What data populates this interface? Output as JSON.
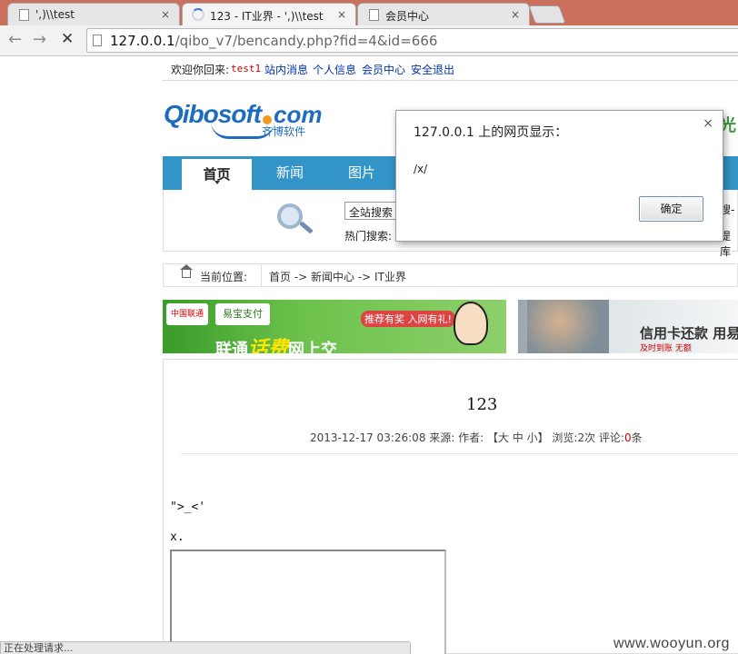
{
  "browser": {
    "tabs": [
      {
        "title": "',)\\\\test",
        "close": "×"
      },
      {
        "title": "123 - IT业界 - ',)\\\\test",
        "close": "×"
      },
      {
        "title": "会员中心",
        "close": "×"
      }
    ],
    "back_icon": "back-arrow-icon",
    "forward_icon": "forward-arrow-icon",
    "stop_icon": "stop-icon",
    "url_host": "127.0.0.1",
    "url_path": "/qibo_v7/bencandy.php?fid=4&id=666"
  },
  "topbar": {
    "welcome": "欢迎你回来:",
    "username": "test1",
    "links": [
      "站内消息",
      "个人信息",
      "会员中心",
      "安全退出"
    ]
  },
  "logo": {
    "brand_left": "Qibosoft",
    "brand_right": "com",
    "brand_cn": "齐博软件"
  },
  "nav": {
    "items": [
      "首页",
      "新闻",
      "图片"
    ]
  },
  "search": {
    "scope_value": "全站搜索",
    "hot_label": "热门搜索:",
    "button_partial": "搜-",
    "hot_partial": "提库"
  },
  "breadcrumb": {
    "label": "当前位置:",
    "path": "首页 -> 新闻中心 -> IT业界"
  },
  "banners": {
    "unicom": "中国联通",
    "pay": "易宝支付",
    "promo": "推荐有奖 入网有礼!",
    "main_prefix": "联通",
    "main_highlight": "话费",
    "main_suffix": "网上交",
    "card_text": "信用卡还款 用易",
    "card_sub": "及时到账  无额"
  },
  "article": {
    "title": "123",
    "meta_prefix": "2013-12-17 03:26:08 来源: 作者: 【大 中 小】 浏览:2次 评论:",
    "comments": "0",
    "meta_suffix": "条",
    "line1": "\">_<'",
    "line2": "x."
  },
  "dialog": {
    "title": "127.0.0.1 上的网页显示：",
    "message": "/x/",
    "ok_label": "确定",
    "close": "×"
  },
  "status": "正在处理请求...",
  "watermark": "www.wooyun.org",
  "colors": {
    "nav_blue": "#3394c7",
    "tabbar": "#c96f5c",
    "link": "#0033aa"
  }
}
